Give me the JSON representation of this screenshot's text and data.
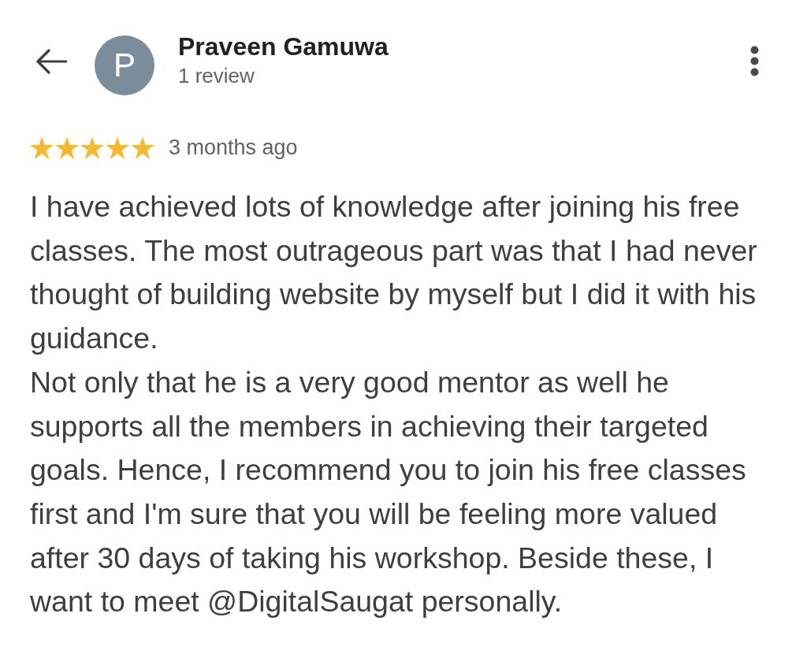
{
  "reviewer": {
    "avatar_initial": "P",
    "name": "Praveen Gamuwa",
    "review_count": "1 review"
  },
  "review": {
    "stars": 5,
    "time": "3 months ago",
    "paragraphs": [
      "I have achieved lots of knowledge after joining his free classes. The most outrageous part was that I had never thought of building website by myself but I did it with his guidance.",
      "Not only that he is a very good mentor as well he supports all the members in achieving their targeted goals. Hence, I recommend you to join his free classes first and I'm sure that you will be feeling more valued after 30 days of taking his workshop. Beside these, I want to meet @DigitalSaugat personally."
    ]
  }
}
